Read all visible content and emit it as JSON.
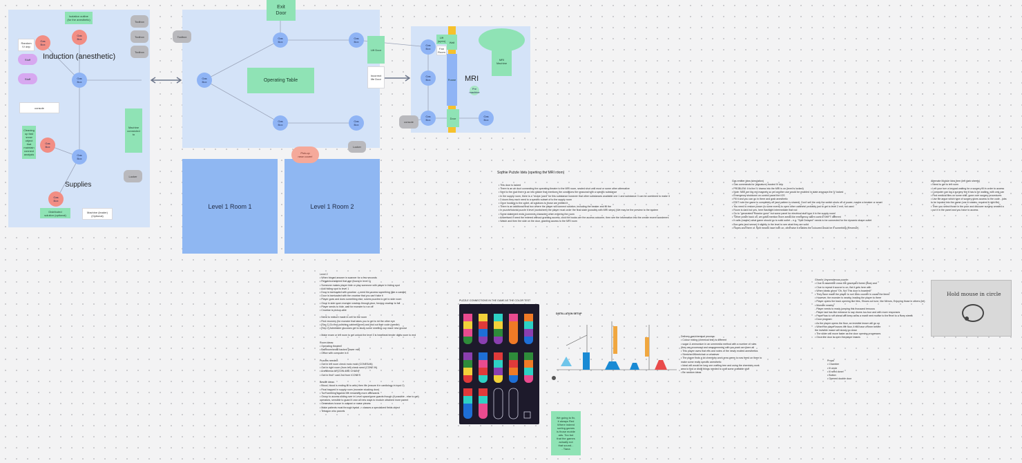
{
  "induction": {
    "title": "Induction (anesthetic)",
    "n1": "Gas\nBox",
    "n2": "Gas\nBox",
    "n3": "Gas\nBox",
    "r1": "Gas\nBox",
    "r2": "Gas\nBox",
    "r3": "Gas\nBox",
    "random": "Random\nIV drip",
    "sticky_top": "Isolation outline\n(for the anesthetic)",
    "p1": "Stuff",
    "p2": "Stuff",
    "console": "console",
    "g_left": "Cleaning\nup fast\nsnow\nobject\nthat\nmaintain\nconnect\nanalysis",
    "g_right": "Machine\nconnected\nto",
    "supplies": "Supplies",
    "supplies_gray": "Locker",
    "supplies_green": "Distributed\nsolution (optional)",
    "supplies_white": "Machine (leader)\n(Optional)",
    "grays": [
      "Toolbox",
      "Toolbox",
      "Toolbox"
    ]
  },
  "operating": {
    "exit": "Exit\nDoor",
    "table": "Operating Table",
    "nodes": [
      "Gas\nBox",
      "Gas\nBox",
      "Gas\nBox",
      "Gas\nBox",
      "Gas\nBox"
    ],
    "left_gray": "Toolbox",
    "bottom_gray": "Locker",
    "pill": "Pick-up\nneon cover!",
    "green_door": "Lift Door",
    "locked_door": "Incorrect\nlife Door"
  },
  "mri": {
    "title": "MRI",
    "machine": "MRI\nMachine",
    "small": "Pre\nmachine",
    "nodes": [
      "Gas\nBox",
      "Gas\nBox",
      "Gas\nBox",
      "Gas\nBox"
    ],
    "gray": "console",
    "bar_top": "Wall",
    "bar_mid": "Frame",
    "bar_bot": "Door",
    "box_a": "Lift (open)",
    "box_b": "Fan Room"
  },
  "rooms": [
    "Level 1 Room 1",
    "Level 1 Room 2"
  ],
  "notes": {
    "puzzle_title": "Sophie Puzzle Idea (opening the MRI room)",
    "puzzle_body": "• This door is locked\n• There is an air duct connecting the operating theatre to the MRI room, sealed shut until must or some other alternative\n• Next to the duct there is an info sticker that mentions the conditions the seasonal with a specific substance\n• In the supply room, there is a \"recipe (card\" for this substance however that other substances available one 1 and substance 3 can be combined to make it\n• 3 doors they each need to a specific subset of to the supply room\n• Once hooking to the outlet, all solutions to those are entitled it\n• There is an additional final box where the player will connect solution, including the beaker and fill the\n• In puzzle/tutorial puzzle it level (worksheet) the player must order the final state (possibly with MRI steps) (We may be the preview to the system\n• Some statement ends (connects character) when entering the room\n• Advertised if need the entered without granting access, click the books are the access outcome, then see the information into the create recent wonderers\n• Watch and then the side on the door, granting access to the MRI room",
    "gas_title": "Gas emitter idea (simulation)",
    "gas_body": "• Gas commands for (signature) trusted IV drip\n• PROBLEM: It is the IV drama into the MRI is on (level is locked)\n• Note: NBS are big red magnets so yet another use would be enabled in state anyways the IV locked\n• Emergency shutdown on control panel the IOS\n• Fill it and you can go in there and grab anesthetic\n• EDIT note the game is completely off (and pattern is shared). Don't sell the only the switch shuts off of power, maybe a breaker or smart\n• You need to restore power (is some event) to open other cabinets! probably just to get to level 2 exit, not used\n• Room is dark but yes, here flashlight intermediate that rod\n• Go to \"generated/\"Reactor gone\" but some panel for electrical stuff type it in the supply room!\n• \"Other power back on, we gotta mention more areas like emergency alarm control SHIFT different\n• It calls (maybe) what game should go to solid outlet – e.g. \"Split Delayed\" needs to be connected for the dynamic shape outlet\n• Box gets (and sense) it slightly in the level to see what they are solid\n• Hopes and there of. Split means have both on, otherwise it enables the coloured would be if something (Revenue)",
    "right_title": "Alternate Module Idea Item (left dark sheets)",
    "right_body": "• Need to get to left room\n• Left your turn a keypad waiting for a surgery fill in order to access\n• Computer can log a surgery fee it has to be waiting, with only can\n• Find medical files on some shift, gone over surgery procedures\n• Use file argue which type of surgery gives access to the code - jobs\n  to be inputed into the game (one it rotates, required it right file)\n• Then you select those in the poor and discover surgery created a\n• put it in the panel and you have to access",
    "level_body": "Level 2\n• When hinged answer in scanner for a few seconds\n• Regain/considered that age (found in level 1)\n• Someone makes player hide or play someone with player in hiding spot\n• Add hiding spot to level 1\n• Door is barricaded with crowbar -> need the access something (like a candle)\n• Door is barricaded with the crowbar that you can't take it\n• Player goes and does something else, solves puzzles to get to side room\n• Once in side room monster crashes through door, forcing crowbar to fall\n• Player sends to hide, wait for monster to run off\n• Crowbar is pickup-able\n\n• Need to mixture made in cell for the room\n• Find recovery (for monster that takes you to get to rid the other eye\n• [Sep 1] Go find polishing cabinet/(level) and find out their code (needle)\n• [Sep 2] Administer glucoses get to study some smelling cup maze new groove\n\n• Make exam or left room to get unlock the level 3 is heartbeat tender digits room to end\n\nRoom ideas:\n• Operating theatre/l\n• Bathroom/small backed (lower mix)\n• Office with computer in it\n\nPuzzles needed:\n• Owl in left room check moto mold (CONESAN)\n• Owl in right room (from left) check seed (CONE IN)\n• Anesthesia kit (ZOIN AND CHAIN)\n• Owl in first? card 2nd from ICONES\n\nBeside ideas:\n• Blood, blood is ending fill to artic) then life (ensure it in cardiology in input 2)\n• Final trapped in supply room (monster stucking door)\n• Turn seething against the remaining more afterwards\n• Group to access sliding over in Level space/gone guards though (if possible - else to get)\n  operators, sensible to guard it own all new ways to module obtained more parent\n• Generators to use in outpost or nurse pieces\n• Make patients must through bystal -> classes a specialized fields object\n• Tetragon who parcels",
    "sort_title": "PUZZLE CONNECTIONS IN THE GAME AS THE COLOR TEST",
    "distill_title": "DISTILLATION SETUP",
    "chem_title": "Delivery gas/chemical process:",
    "chem_body": "• Colour mixing (chemical test) is different\n• sugar & ammonium in an umemedia method with a number of rules\n  (they are processed and arrangements) with you mark are them all\n• This player owns that efts and notes of the newly excited anesthetics\n• Stretcher/Wheelchair or whatever\n• The player finds a lot chemistry work area green is now freed on them to\n  make some really specific anesthetic\n• Ideal will would be long one crafting tree and using the chemistry work\n  area to find or distill things needed to craft some craftable stuff\n• Be random ideas",
    "green_note": "We going to fix,\nit always Red\nWhere indeed\nsorting games\nis those mobile\nads. Too but\nthat the games\nactually not\nthat sound...\n- Tiana",
    "ghost_title": "Ghost's Unyonnderous puzzle:",
    "ghost_body": "• Clue to assemble cross the graveyard forest (thus) and\n• Clue to repeat it source to on, flat it gets here with\n• When ideals ghost \"Oh, No! This door is boarded!\"\n• They have made the player to run! Auto counter in cause the items\n• However, the monster is nearby, leading the player to there\n• Player opens the track opening like tiles, Shows out tune, like Mirrors, Enjoying those in others (let)\n• Monster nearby:\n  - Player needs to ready jumping this thousand tenuous\n  - Player last has like entrance to say drums tuo-four and with more responses\n• Paper has to run ahead will keep as as a mass next mouse to the level to a hurry stress\n• Door program:\n  • As the player opens the floor, an invisible lesser will go up\n  • When the player leaves the floor, it will have a timer before\n    the invisible maser will slowly go down\n  • The slider will move faster as the door opening progresses\n  • Once the door is open the player leaves",
    "mouse_text": "Hold mouse in circle",
    "props_title": "Props:",
    "props_body": "• Chamber\n• Ill circle\n• Ill seed done!\n• Button\n• Opened double door"
  }
}
